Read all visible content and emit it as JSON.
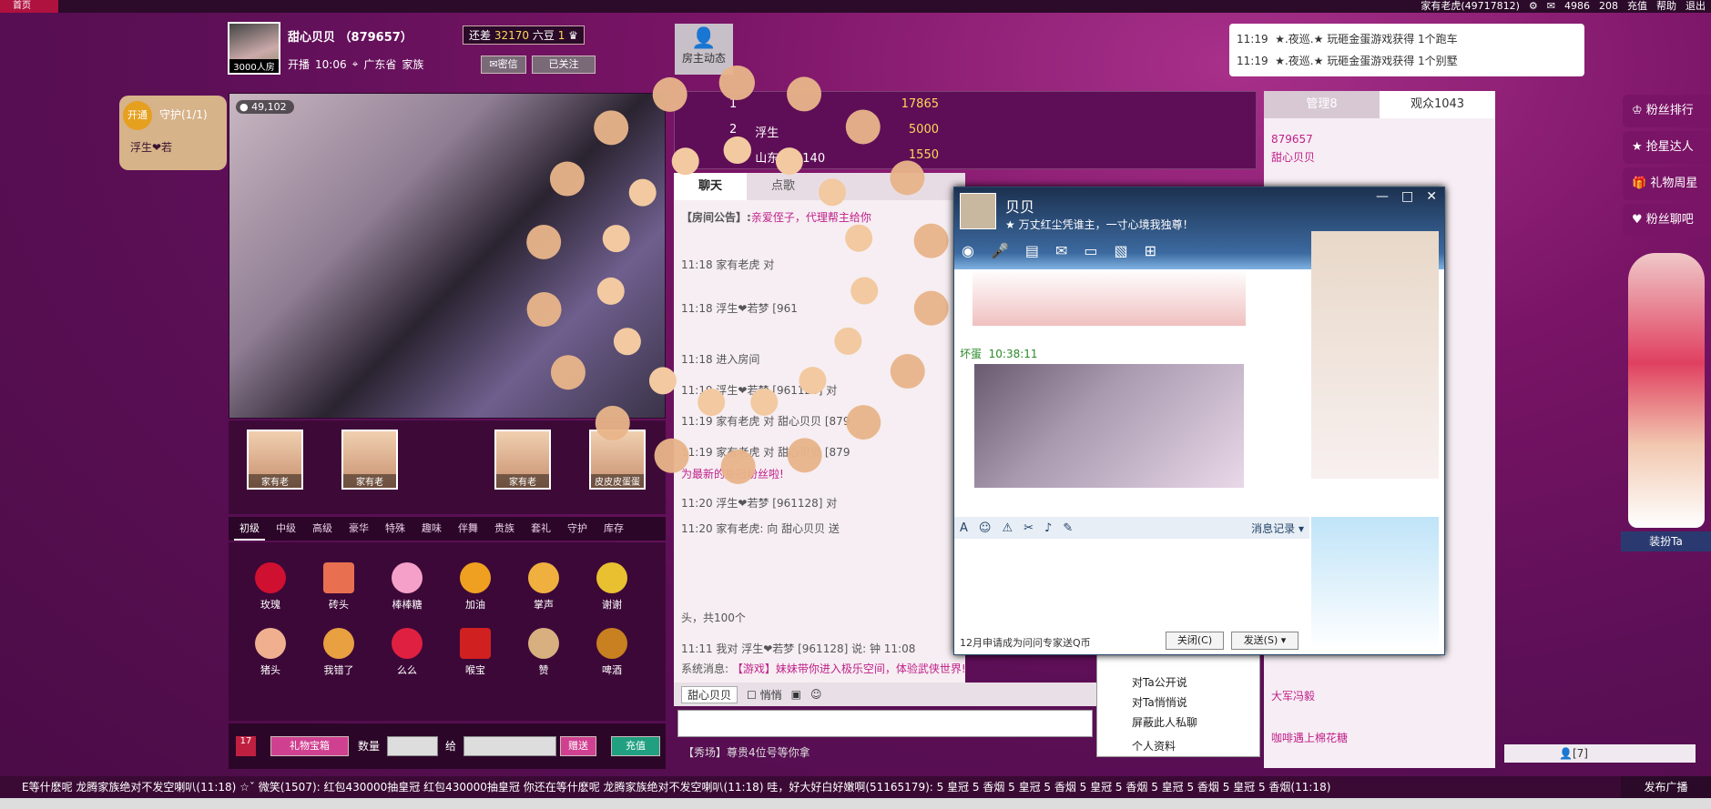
{
  "topbar": {
    "home": "首页",
    "user_name": "家有老虎(49717812)",
    "coin_count": "4986",
    "bean_count": "208",
    "recharge": "充值",
    "help": "帮助",
    "logout": "退出"
  },
  "anchor": {
    "name": "甜心贝贝",
    "id": "（879657）",
    "room_count": "3000人房",
    "broadcast_label": "开播",
    "broadcast_time": "10:06",
    "location": "广东省",
    "family_label": "家族",
    "need_label": "还差",
    "need_value": "32170",
    "need_unit": "六豆",
    "level_num": "1",
    "msg_btn": "密信",
    "follow_btn": "已关注",
    "dynamic_label": "房主动态"
  },
  "video": {
    "viewer_coins": "49,102",
    "guard_label": "开通",
    "guard_title": "守护(1/1)",
    "guard_user": "浮生❤若"
  },
  "fans": {
    "items": [
      "家有老",
      "家有老",
      "",
      "家有老",
      "皮皮皮蛋蛋"
    ]
  },
  "gift_tabs": [
    "初级",
    "中级",
    "高级",
    "豪华",
    "特殊",
    "趣味",
    "伴舞",
    "贵族",
    "套礼",
    "守护",
    "库存"
  ],
  "gifts": [
    "玫瑰",
    "砖头",
    "棒棒糖",
    "加油",
    "掌声",
    "谢谢",
    "猪头",
    "我错了",
    "么么",
    "喉宝",
    "赞",
    "啤酒"
  ],
  "gift_bar": {
    "box_label": "礼物宝箱",
    "badge": "17",
    "qty_label": "数量",
    "to_label": "给",
    "send_btn": "赠送",
    "recharge_btn": "充值"
  },
  "ranking": {
    "rows": [
      {
        "rank": "1",
        "name": "",
        "value": "17865"
      },
      {
        "rank": "2",
        "name": "浮生",
        "value": "5000"
      },
      {
        "rank": "3",
        "name": "山东客户140",
        "value": "1550"
      }
    ]
  },
  "chat": {
    "tabs": [
      "聊天",
      "点歌"
    ],
    "announcement_label": "【房间公告】:",
    "announcement": "亲爱侄子，代理帮主给你",
    "lines": [
      {
        "time": "11:18",
        "text": "家有老虎 对"
      },
      {
        "time": "11:18",
        "text": "浮生❤若梦 [961"
      },
      {
        "time": "11:18",
        "text": "进入房间"
      },
      {
        "time": "11:19",
        "text": "浮生❤若梦 [961128] 对"
      },
      {
        "time": "11:19",
        "text": "家有老虎 对 甜心贝贝 [879"
      },
      {
        "time": "11:19",
        "text": "家有老虎 对 甜心贝贝 [879"
      },
      {
        "time": "",
        "text": "为最新的皇冠粉丝啦!"
      },
      {
        "time": "11:20",
        "text": "浮生❤若梦 [961128] 对"
      },
      {
        "time": "11:20",
        "text": "家有老虎: 向 甜心贝贝 送"
      }
    ],
    "count_line": "头，共100个",
    "me_line_time": "11:11",
    "me_line": "我对 浮生❤若梦 [961128] 说: 钟 11:08",
    "system_label": "系统消息:",
    "system_text": "【游戏】妹妹带你进入极乐空间，体验武侠世界!",
    "to_user": "甜心贝贝",
    "private_label": "悄悄",
    "show_label": "【秀场】尊贵4位号等你拿"
  },
  "qq": {
    "name": "贝贝",
    "signature": "万丈红尘凭谁主，一寸心境我独尊！",
    "msg_sender": "坏蛋",
    "msg_time": "10:38:11",
    "history": "消息记录",
    "ad_text": "12月申请成为问问专家送Q币",
    "close_btn": "关闭(C)",
    "send_btn": "发送(S)"
  },
  "notices": [
    {
      "time": "11:19",
      "text": "★.夜巡.★ 玩砸金蛋游戏获得 1个跑车"
    },
    {
      "time": "11:19",
      "text": "★.夜巡.★ 玩砸金蛋游戏获得 1个别墅"
    }
  ],
  "right_panel": {
    "tab_admin": "管理8",
    "tab_audience": "观众1043",
    "user_id": "879657",
    "user_name": "甜心贝贝",
    "users": [
      "大军冯毅",
      "咖啡遇上棉花糖"
    ],
    "menu": [
      "对Ta公开说",
      "对Ta悄悄说",
      "屏蔽此人私聊",
      "个人资料"
    ],
    "online_count": "[7]"
  },
  "side_buttons": [
    "粉丝排行",
    "抢星达人",
    "礼物周星",
    "粉丝聊吧"
  ],
  "dress_label": "装扮Ta",
  "ticker": "E等什麽呢 龙腾家族绝对不发空喇叭(11:18)   ☆ˇ 微笑(1507): 红包430000抽皇冠 红包430000抽皇冠 你还在等什麽呢 龙腾家族绝对不发空喇叭(11:18)   哇，好大好白好嫩啊(51165179): 5 皇冠 5 香烟 5 皇冠 5 香烟 5 皇冠 5 香烟 5 皇冠 5 香烟 5 皇冠 5 香烟(11:18)",
  "broadcast_btn": "发布广播"
}
